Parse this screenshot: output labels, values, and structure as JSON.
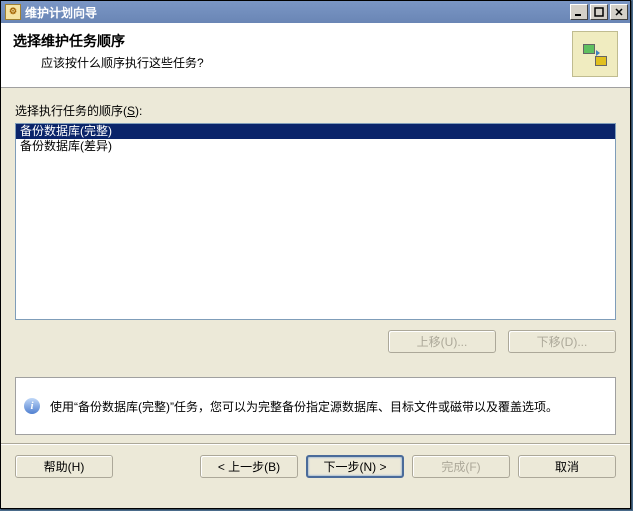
{
  "window": {
    "title": "维护计划向导"
  },
  "header": {
    "title": "选择维护任务顺序",
    "subtitle": "应该按什么顺序执行这些任务?"
  },
  "order": {
    "label_prefix": "选择执行任务的顺序(",
    "label_accel": "S",
    "label_suffix": "):"
  },
  "list": {
    "items": [
      {
        "label": "备份数据库(完整)",
        "selected": true
      },
      {
        "label": "备份数据库(差异)",
        "selected": false
      }
    ]
  },
  "buttons": {
    "move_up": "上移(U)...",
    "move_down": "下移(D)...",
    "help": "帮助(H)",
    "back": "< 上一步(B)",
    "next": "下一步(N) >",
    "finish": "完成(F)",
    "cancel": "取消"
  },
  "info": {
    "text": "使用“备份数据库(完整)”任务，您可以为完整备份指定源数据库、目标文件或磁带以及覆盖选项。"
  }
}
